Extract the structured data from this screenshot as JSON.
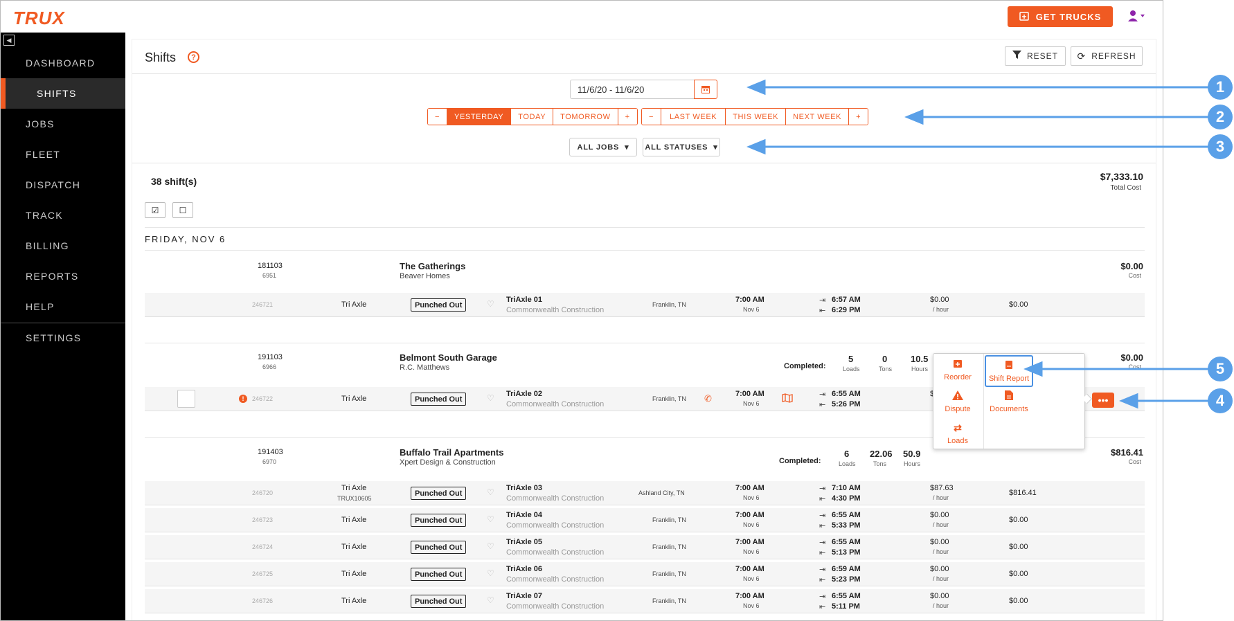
{
  "app": {
    "logo": "TRUX",
    "get_trucks": "GET TRUCKS"
  },
  "sidebar": {
    "items": [
      "DASHBOARD",
      "SHIFTS",
      "JOBS",
      "FLEET",
      "DISPATCH",
      "TRACK",
      "BILLING",
      "REPORTS",
      "HELP",
      "SETTINGS"
    ],
    "active": "SHIFTS"
  },
  "header": {
    "title": "Shifts",
    "reset": "RESET",
    "refresh": "REFRESH"
  },
  "filters": {
    "date_range": "11/6/20  -  11/6/20",
    "day_buttons": [
      "−",
      "YESTERDAY",
      "TODAY",
      "TOMORROW",
      "+"
    ],
    "week_buttons": [
      "−",
      "LAST WEEK",
      "THIS WEEK",
      "NEXT WEEK",
      "+"
    ],
    "jobs_dropdown": "ALL JOBS",
    "status_dropdown": "ALL STATUSES"
  },
  "summary": {
    "count": "38 shift(s)",
    "total_cost": "$7,333.10",
    "total_cost_label": "Total Cost"
  },
  "day_header": "FRIDAY, NOV 6",
  "jobs": [
    {
      "id": "181103",
      "sub_id": "6951",
      "name": "The Gatherings",
      "client": "Beaver Homes",
      "cost": "$0.00",
      "cost_label": "Cost"
    },
    {
      "id": "191103",
      "sub_id": "6966",
      "name": "Belmont South Garage",
      "client": "R.C. Matthews",
      "completed_label": "Completed:",
      "loads": "5",
      "loads_label": "Loads",
      "tons": "0",
      "tons_label": "Tons",
      "hours": "10.5",
      "hours_label": "Hours",
      "cost": "$0.00",
      "cost_label": "Cost"
    },
    {
      "id": "191403",
      "sub_id": "6970",
      "name": "Buffalo Trail Apartments",
      "client": "Xpert Design & Construction",
      "completed_label": "Completed:",
      "loads": "6",
      "loads_label": "Loads",
      "tons": "22.06",
      "tons_label": "Tons",
      "hours": "50.9",
      "hours_label": "Hours",
      "cost": "$816.41",
      "cost_label": "Cost"
    }
  ],
  "shifts": [
    {
      "id": "246721",
      "type": "Tri Axle",
      "status": "Punched Out",
      "truck": "TriAxle 01",
      "company": "Commonwealth Construction",
      "city": "Franklin, TN",
      "start": "7:00 AM",
      "date": "Nov 6",
      "in": "6:57 AM",
      "out": "6:29 PM",
      "rate": "$0.00",
      "per": "/ hour",
      "cost": "$0.00"
    },
    {
      "id": "246722",
      "type": "Tri Axle",
      "status": "Punched Out",
      "truck": "TriAxle 02",
      "company": "Commonwealth Construction",
      "city": "Franklin, TN",
      "start": "7:00 AM",
      "date": "Nov 6",
      "in": "6:55 AM",
      "out": "5:26 PM",
      "rate": "$0",
      "per": "",
      "cost": ""
    },
    {
      "id": "246720",
      "type": "Tri Axle",
      "type_sub": "TRUX10605",
      "status": "Punched Out",
      "truck": "TriAxle 03",
      "company": "Commonwealth Construction",
      "city": "Ashland City, TN",
      "start": "7:00 AM",
      "date": "Nov 6",
      "in": "7:10 AM",
      "out": "4:30 PM",
      "rate": "$87.63",
      "per": "/ hour",
      "cost": "$816.41"
    },
    {
      "id": "246723",
      "type": "Tri Axle",
      "status": "Punched Out",
      "truck": "TriAxle 04",
      "company": "Commonwealth Construction",
      "city": "Franklin, TN",
      "start": "7:00 AM",
      "date": "Nov 6",
      "in": "6:55 AM",
      "out": "5:33 PM",
      "rate": "$0.00",
      "per": "/ hour",
      "cost": "$0.00"
    },
    {
      "id": "246724",
      "type": "Tri Axle",
      "status": "Punched Out",
      "truck": "TriAxle 05",
      "company": "Commonwealth Construction",
      "city": "Franklin, TN",
      "start": "7:00 AM",
      "date": "Nov 6",
      "in": "6:55 AM",
      "out": "5:13 PM",
      "rate": "$0.00",
      "per": "/ hour",
      "cost": "$0.00"
    },
    {
      "id": "246725",
      "type": "Tri Axle",
      "status": "Punched Out",
      "truck": "TriAxle 06",
      "company": "Commonwealth Construction",
      "city": "Franklin, TN",
      "start": "7:00 AM",
      "date": "Nov 6",
      "in": "6:59 AM",
      "out": "5:23 PM",
      "rate": "$0.00",
      "per": "/ hour",
      "cost": "$0.00"
    },
    {
      "id": "246726",
      "type": "Tri Axle",
      "status": "Punched Out",
      "truck": "TriAxle 07",
      "company": "Commonwealth Construction",
      "city": "Franklin, TN",
      "start": "7:00 AM",
      "date": "Nov 6",
      "in": "6:55 AM",
      "out": "5:11 PM",
      "rate": "$0.00",
      "per": "/ hour",
      "cost": "$0.00"
    }
  ],
  "popup": {
    "reorder": "Reorder",
    "shift_report": "Shift Report",
    "dispute": "Dispute",
    "documents": "Documents",
    "loads": "Loads"
  },
  "callouts": [
    "1",
    "2",
    "3",
    "4",
    "5"
  ],
  "colors": {
    "accent": "#f05a22",
    "callout": "#5aa0e8"
  }
}
